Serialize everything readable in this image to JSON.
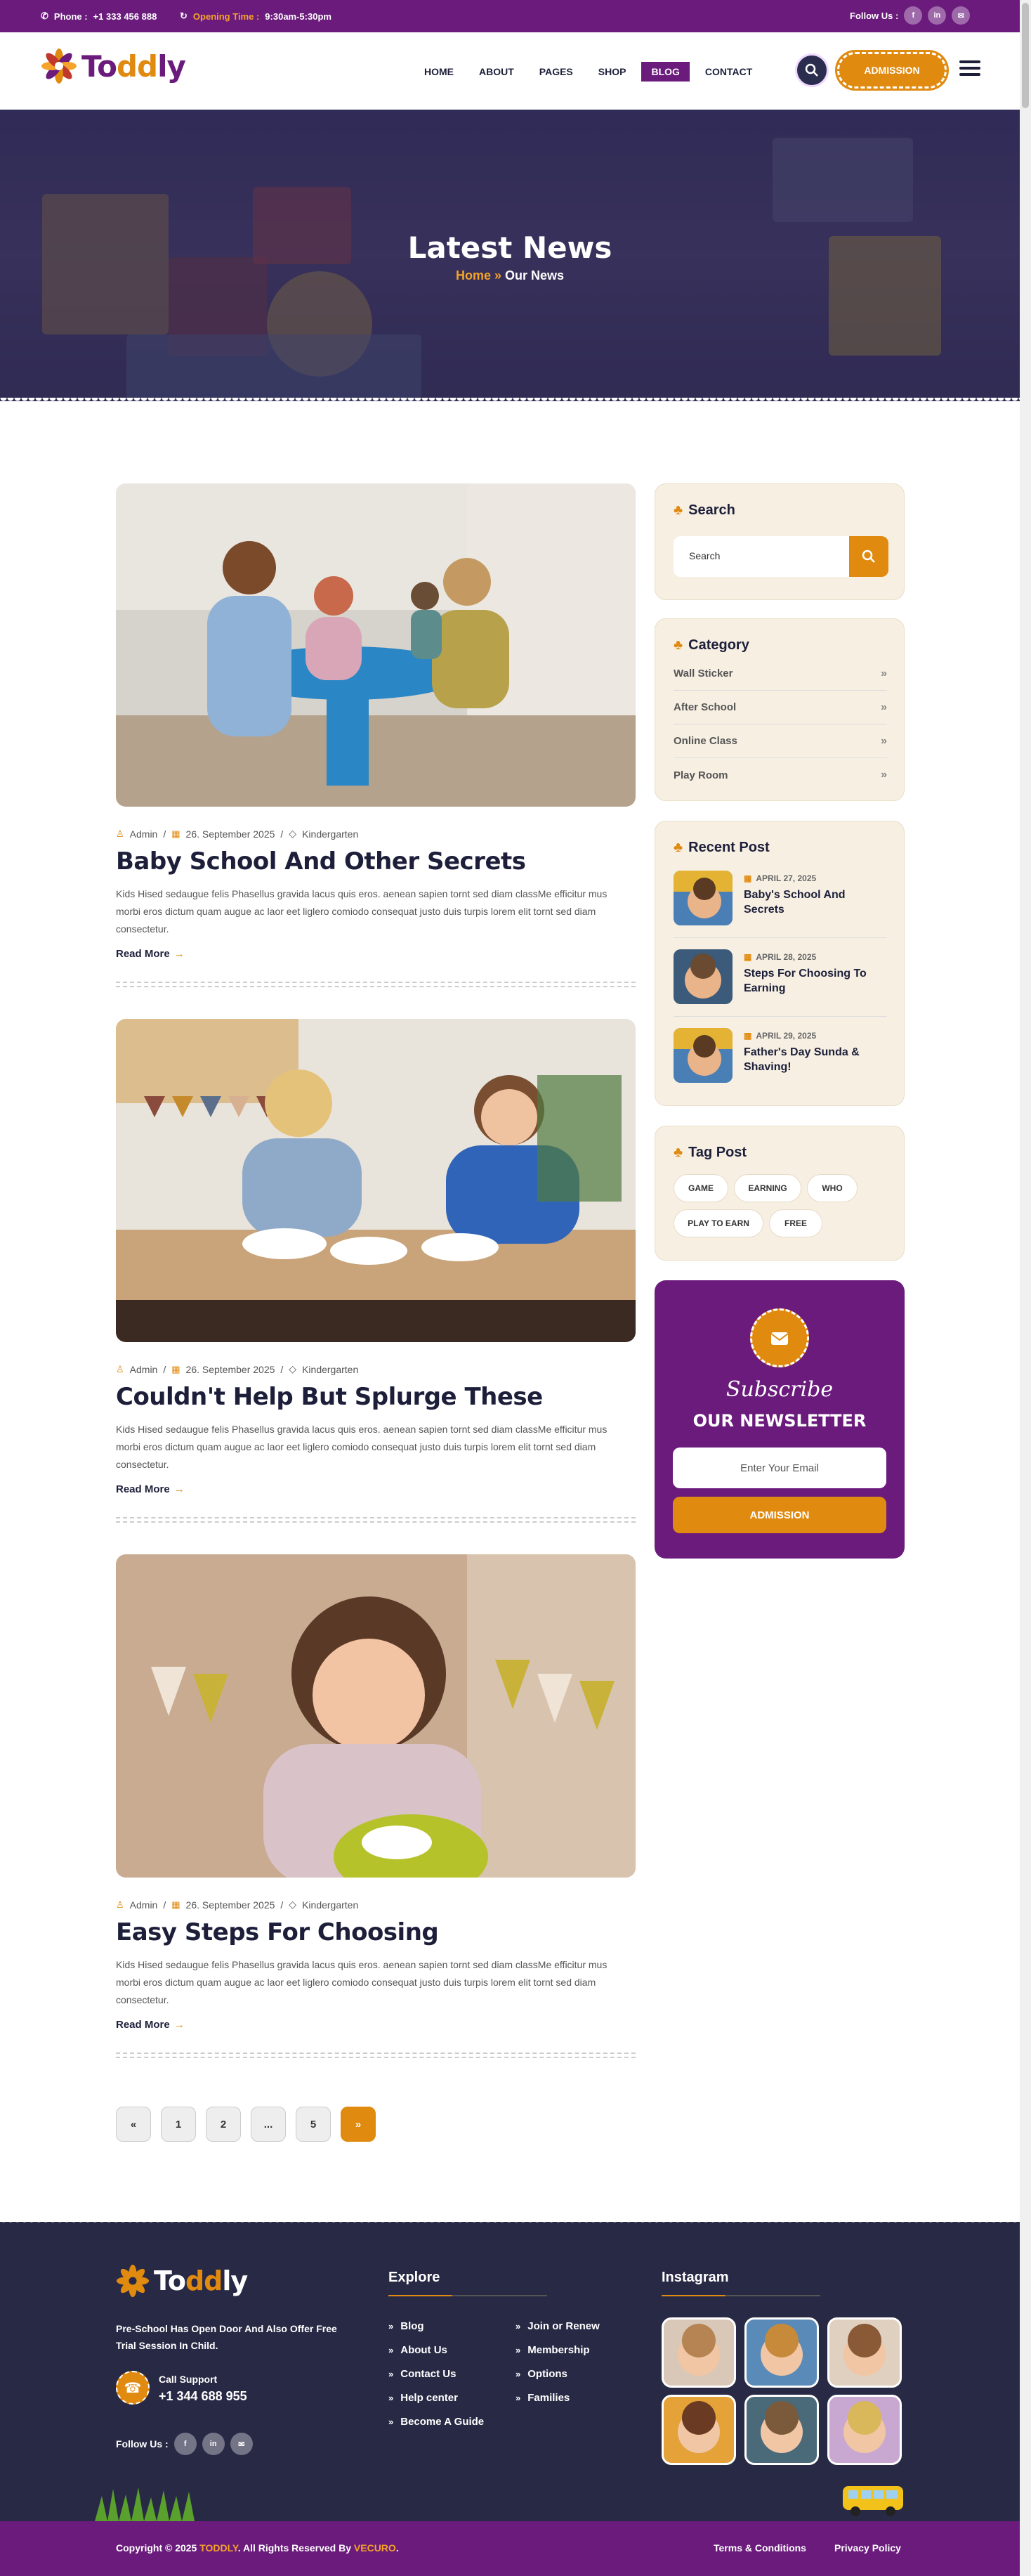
{
  "topbar": {
    "phone_label": "Phone :",
    "phone": "+1 333 456 888",
    "opening_label": "Opening Time :",
    "opening": "9:30am-5:30pm",
    "follow": "Follow Us :",
    "socials": [
      "f",
      "in",
      "✉"
    ]
  },
  "header": {
    "logo_a": "To",
    "logo_b": "dd",
    "logo_c": "ly",
    "nav": [
      "HOME",
      "ABOUT",
      "PAGES",
      "SHOP",
      "BLOG",
      "CONTACT"
    ],
    "admission": "ADMISSION"
  },
  "hero": {
    "title": "Latest News",
    "crumb_home": "Home",
    "crumb_sep": "»",
    "crumb_current": "Our News"
  },
  "posts": [
    {
      "author": "Admin",
      "date": "26. September 2025",
      "category": "Kindergarten",
      "title": "Baby School And Other Secrets",
      "excerpt": "Kids Hised sedaugue felis Phasellus gravida lacus quis eros. aenean sapien tornt sed diam classMe efficitur mus morbi eros dictum quam augue ac laor eet liglero comiodo consequat justo duis turpis lorem elit tornt sed diam consectetur.",
      "read_more": "Read More"
    },
    {
      "author": "Admin",
      "date": "26. September 2025",
      "category": "Kindergarten",
      "title": "Couldn't Help But Splurge These",
      "excerpt": "Kids Hised sedaugue felis Phasellus gravida lacus quis eros. aenean sapien tornt sed diam classMe efficitur mus morbi eros dictum quam augue ac laor eet liglero comiodo consequat justo duis turpis lorem elit tornt sed diam consectetur.",
      "read_more": "Read More"
    },
    {
      "author": "Admin",
      "date": "26. September 2025",
      "category": "Kindergarten",
      "title": "Easy Steps For Choosing",
      "excerpt": "Kids Hised sedaugue felis Phasellus gravida lacus quis eros. aenean sapien tornt sed diam classMe efficitur mus morbi eros dictum quam augue ac laor eet liglero comiodo consequat justo duis turpis lorem elit tornt sed diam consectetur.",
      "read_more": "Read More"
    }
  ],
  "pagination": [
    "«",
    "1",
    "2",
    "...",
    "5",
    "»"
  ],
  "sidebar": {
    "search_title": "Search",
    "search_placeholder": "Search",
    "category_title": "Category",
    "categories": [
      "Wall Sticker",
      "After School",
      "Online Class",
      "Play Room"
    ],
    "recent_title": "Recent Post",
    "recent": [
      {
        "date": "APRIL 27, 2025",
        "title": "Baby's School And Secrets"
      },
      {
        "date": "APRIL 28, 2025",
        "title": "Steps For Choosing To Earning"
      },
      {
        "date": "APRIL 29, 2025",
        "title": "Father's Day Sunda & Shaving!"
      }
    ],
    "tag_title": "Tag Post",
    "tags": [
      "GAME",
      "EARNING",
      "WHO",
      "PLAY TO EARN",
      "FREE"
    ],
    "newsletter_sub": "Subscribe",
    "newsletter_title": "OUR NEWSLETTER",
    "newsletter_placeholder": "Enter Your Email",
    "newsletter_button": "ADMISSION"
  },
  "footer": {
    "about": "Pre-School Has Open Door And Also Offer Free Trial Session In Child.",
    "call_label": "Call Support",
    "call_number": "+1 344 688 955",
    "follow": "Follow Us :",
    "explore_title": "Explore",
    "explore_col1": [
      "Blog",
      "About Us",
      "Contact Us",
      "Help center",
      "Become A Guide"
    ],
    "explore_col2": [
      "Join or Renew",
      "Membership",
      "Options",
      "Families"
    ],
    "instagram_title": "Instagram",
    "copyright_a": "Copyright © 2025 ",
    "copyright_brand": "TODDLY",
    "copyright_b": ". All Rights Reserved By ",
    "copyright_owner": "VECURO",
    "copyright_c": ".",
    "terms": "Terms & Conditions",
    "privacy": "Privacy Policy"
  },
  "colors": {
    "purple": "#6a1b7c",
    "orange": "#e08a10",
    "navy": "#282a45",
    "cream": "#f6efe2"
  }
}
